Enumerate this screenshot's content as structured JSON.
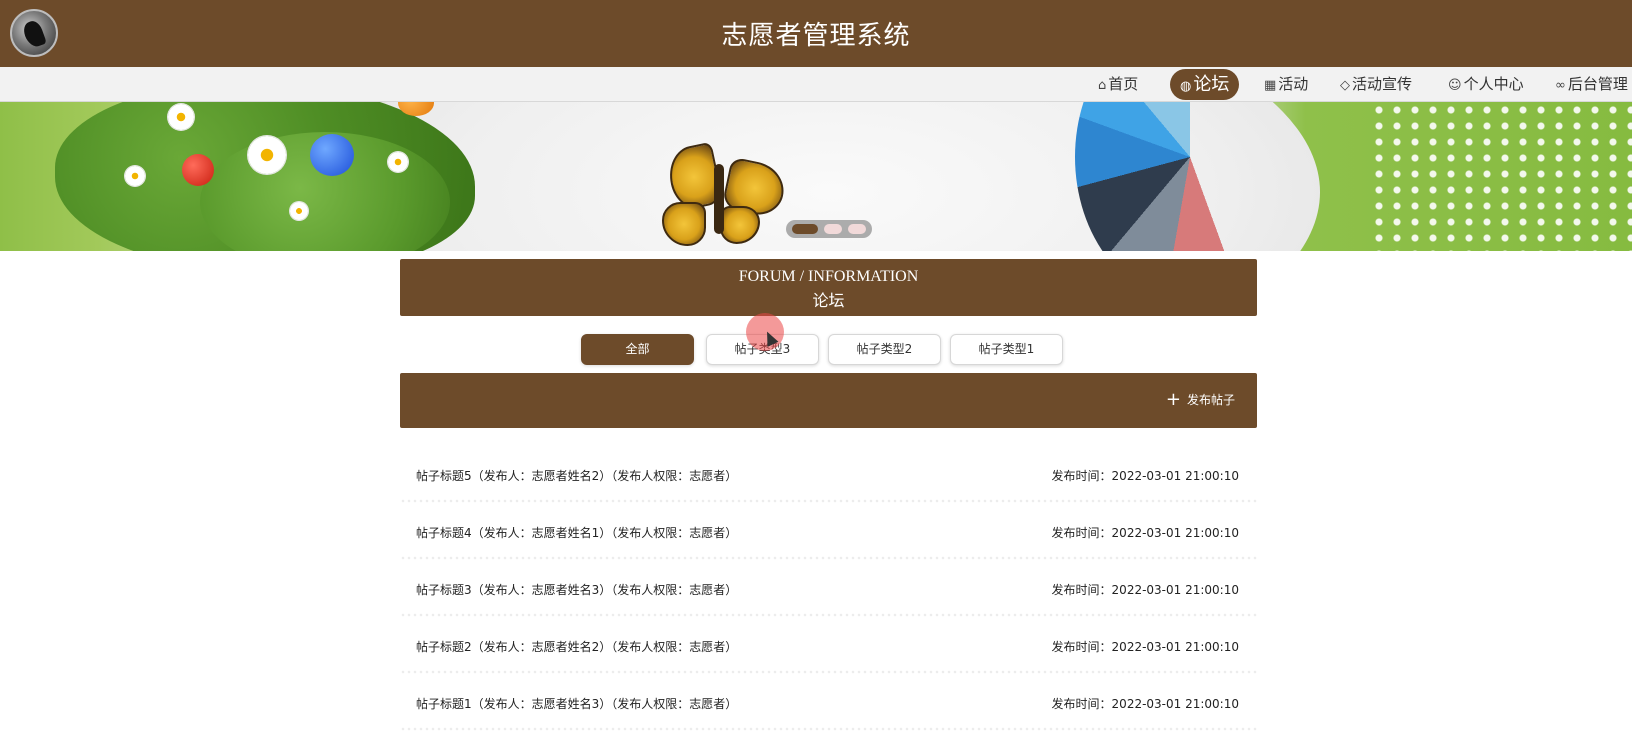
{
  "app": {
    "title": "志愿者管理系统"
  },
  "nav": {
    "items": [
      {
        "label": "首页",
        "icon": "home-icon",
        "active": false
      },
      {
        "label": "论坛",
        "icon": "globe-icon",
        "active": true
      },
      {
        "label": "活动",
        "icon": "grid-icon",
        "active": false
      },
      {
        "label": "活动宣传",
        "icon": "tag-icon",
        "active": false
      },
      {
        "label": "个人中心",
        "icon": "user-icon",
        "active": false
      },
      {
        "label": "后台管理",
        "icon": "link-icon",
        "active": false
      }
    ]
  },
  "banner": {
    "slide_count": 3,
    "active_slide": 1
  },
  "section": {
    "title_en": "FORUM / INFORMATION",
    "title_cn": "论坛"
  },
  "tabs": [
    {
      "label": "全部",
      "active": true
    },
    {
      "label": "帖子类型3",
      "active": false
    },
    {
      "label": "帖子类型2",
      "active": false
    },
    {
      "label": "帖子类型1",
      "active": false
    }
  ],
  "actions": {
    "publish_label": "发布帖子",
    "publish_icon": "plus-icon"
  },
  "posts": [
    {
      "title": "帖子标题5（发布人：志愿者姓名2）（发布人权限：志愿者）",
      "time": "发布时间：2022-03-01 21:00:10"
    },
    {
      "title": "帖子标题4（发布人：志愿者姓名1）（发布人权限：志愿者）",
      "time": "发布时间：2022-03-01 21:00:10"
    },
    {
      "title": "帖子标题3（发布人：志愿者姓名3）（发布人权限：志愿者）",
      "time": "发布时间：2022-03-01 21:00:10"
    },
    {
      "title": "帖子标题2（发布人：志愿者姓名2）（发布人权限：志愿者）",
      "time": "发布时间：2022-03-01 21:00:10"
    },
    {
      "title": "帖子标题1（发布人：志愿者姓名3）（发布人权限：志愿者）",
      "time": "发布时间：2022-03-01 21:00:10"
    }
  ],
  "colors": {
    "primary": "#6d4b2a",
    "nav_bg": "#f2f2f2",
    "page_bg": "#ffffff"
  }
}
